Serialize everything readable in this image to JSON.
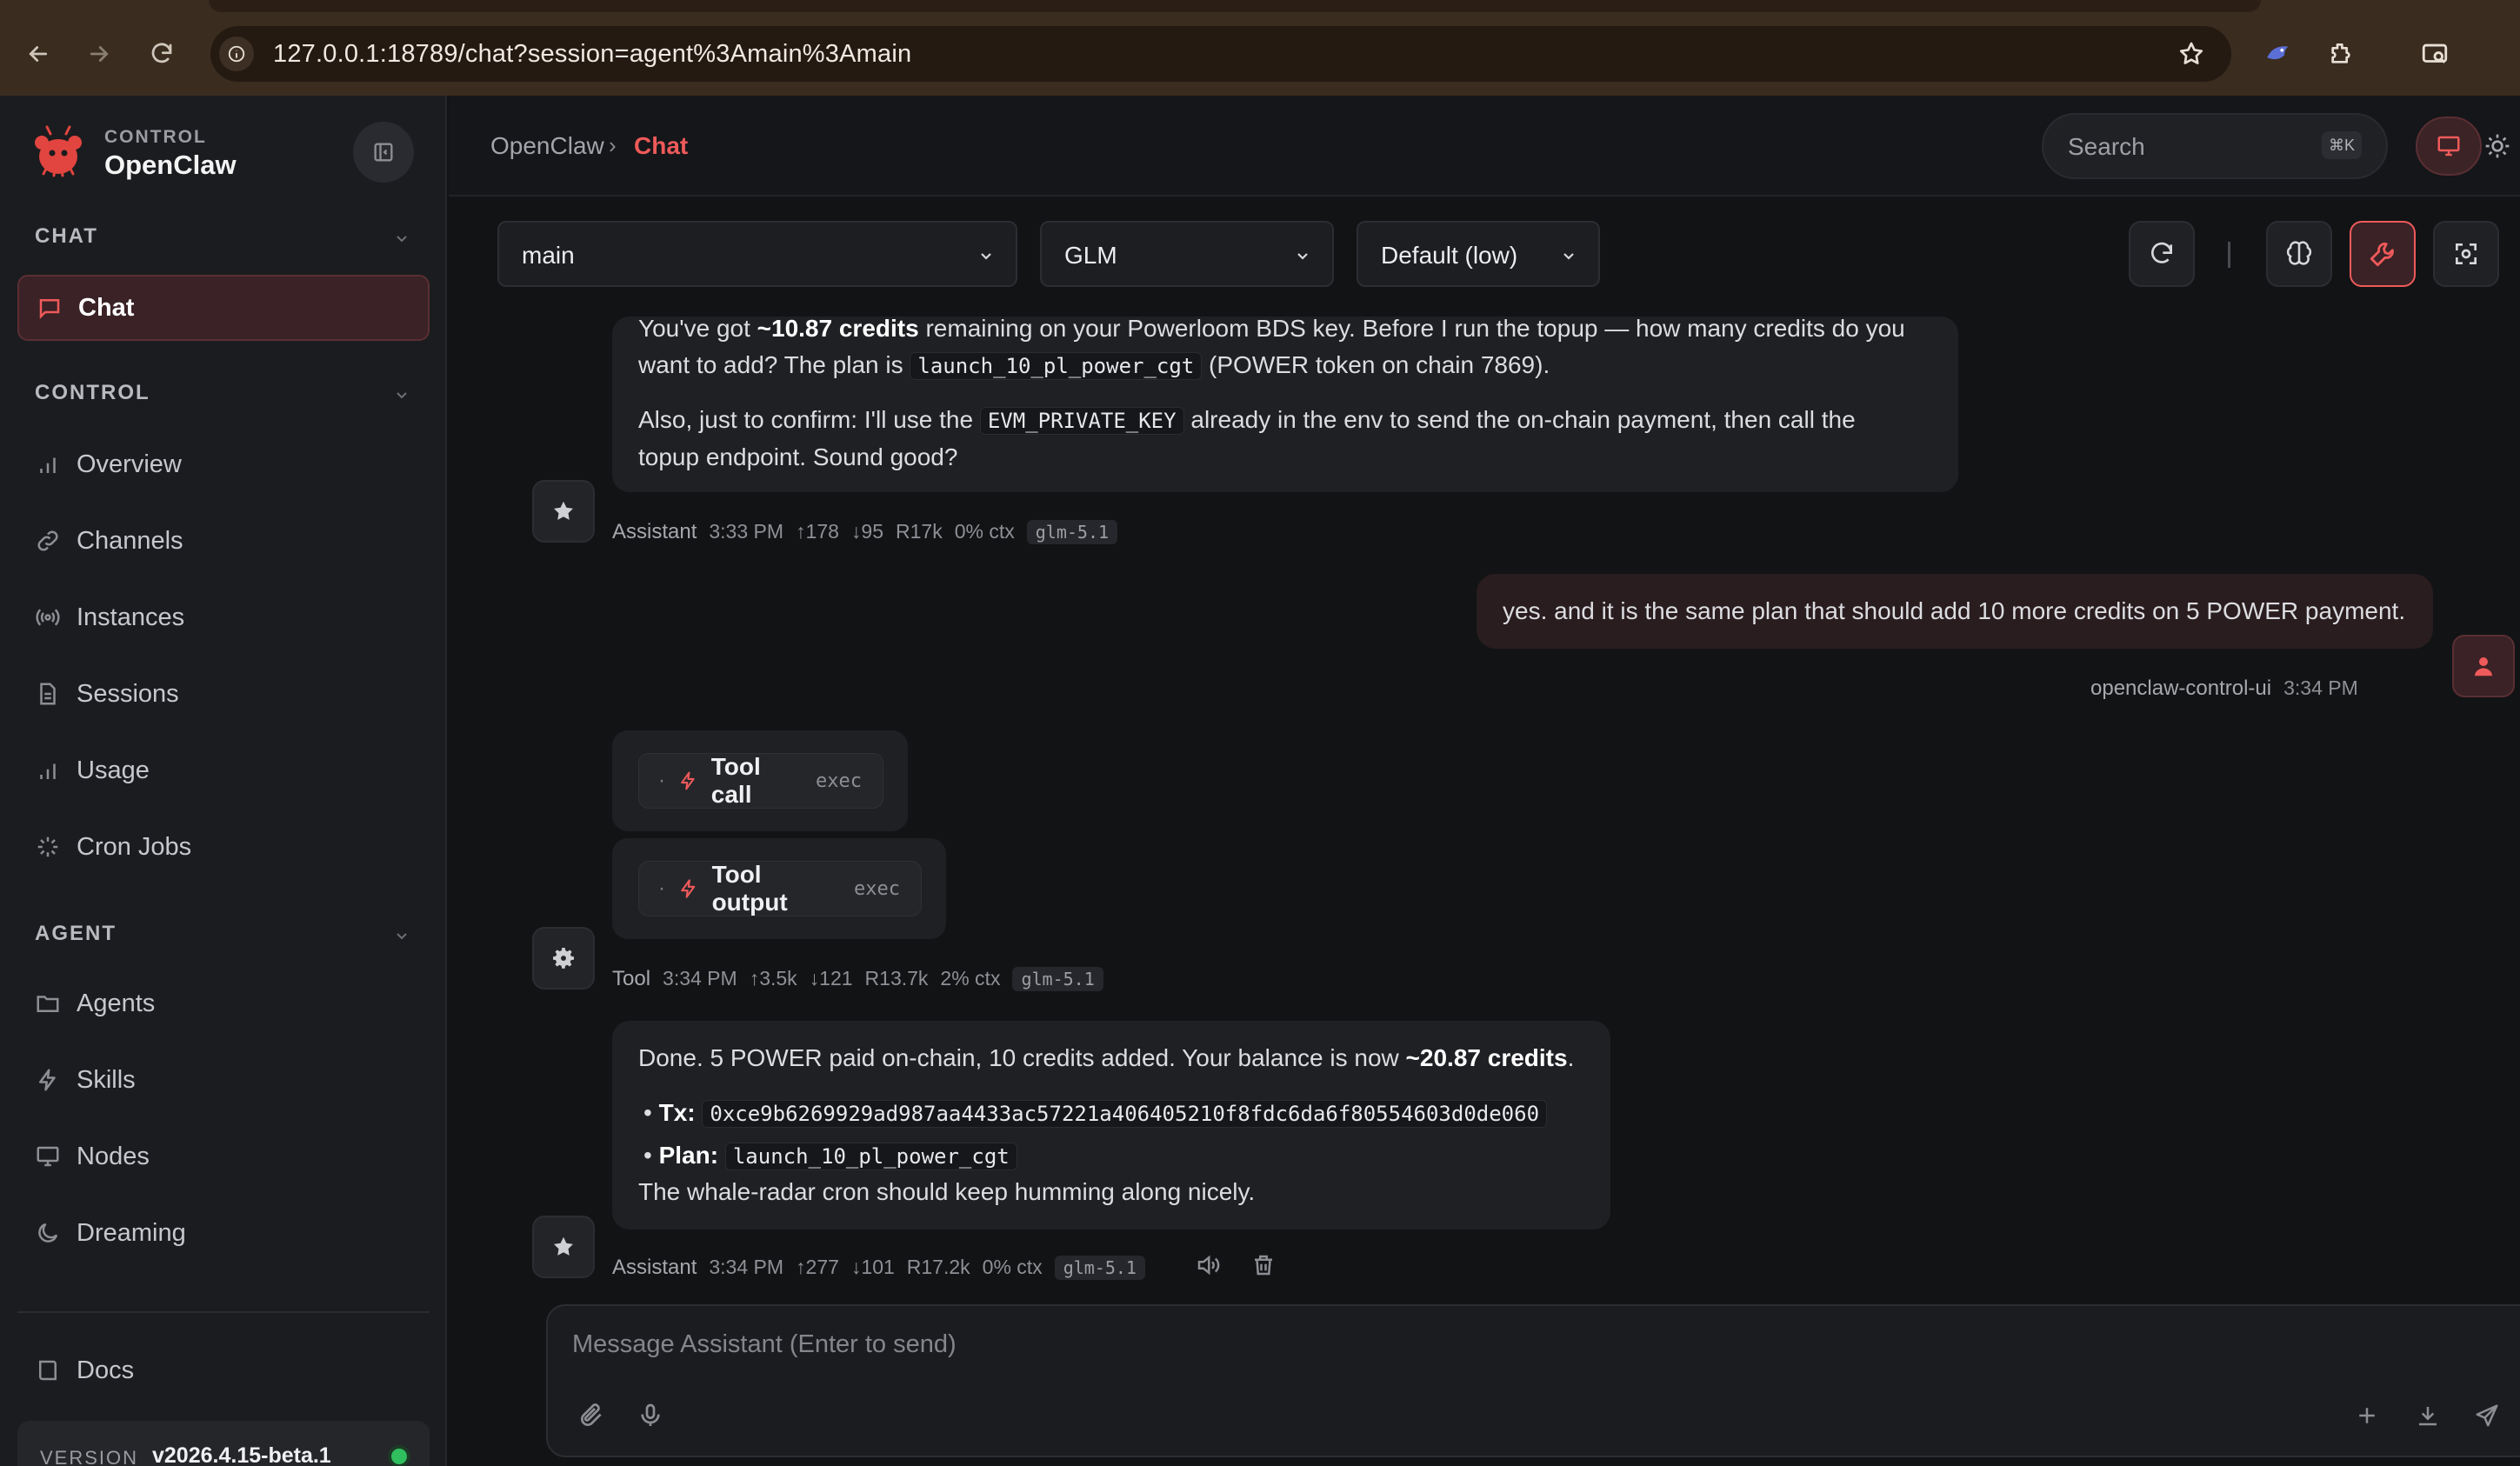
{
  "browser": {
    "url": "127.0.0.1:18789/chat?session=agent%3Amain%3Amain"
  },
  "brand": {
    "kicker": "CONTROL",
    "name": "OpenClaw"
  },
  "sidebar": {
    "sections": [
      {
        "title": "CHAT",
        "items": [
          {
            "label": "Chat",
            "active": true,
            "icon": "chat-bubble-icon"
          }
        ]
      },
      {
        "title": "CONTROL",
        "items": [
          {
            "label": "Overview",
            "icon": "bar-chart-icon"
          },
          {
            "label": "Channels",
            "icon": "link-icon"
          },
          {
            "label": "Instances",
            "icon": "radio-icon"
          },
          {
            "label": "Sessions",
            "icon": "file-icon"
          },
          {
            "label": "Usage",
            "icon": "bar-chart-icon"
          },
          {
            "label": "Cron Jobs",
            "icon": "loader-icon"
          }
        ]
      },
      {
        "title": "AGENT",
        "items": [
          {
            "label": "Agents",
            "icon": "folder-icon"
          },
          {
            "label": "Skills",
            "icon": "bolt-icon"
          },
          {
            "label": "Nodes",
            "icon": "monitor-icon"
          },
          {
            "label": "Dreaming",
            "icon": "moon-icon"
          }
        ]
      }
    ],
    "docs": "Docs",
    "version_label": "VERSION",
    "version_value": "v2026.4.15-beta.1"
  },
  "header": {
    "breadcrumb_root": "OpenClaw",
    "breadcrumb_sep": "›",
    "breadcrumb_current": "Chat",
    "search_placeholder": "Search",
    "search_shortcut": "⌘K"
  },
  "controls": {
    "session": "main",
    "model": "GLM",
    "thinking": "Default (low)"
  },
  "messages": {
    "m1": {
      "p1_a": "You've got ",
      "p1_b": "~10.87 credits",
      "p1_c": " remaining on your Powerloom BDS key. Before I run the topup — how many credits do you",
      "p1_d": "want to add? The plan is ",
      "p1_code": "launch_10_pl_power_cgt",
      "p1_e": " (POWER token on chain 7869).",
      "p2_a": "Also, just to confirm: I'll use the ",
      "p2_code": "EVM_PRIVATE_KEY",
      "p2_b": " already in the env to send the on-chain payment, then call the",
      "p2_c": "topup endpoint. Sound good?",
      "role": "Assistant",
      "time": "3:33 PM",
      "up": "↑178",
      "down": "↓95",
      "r": "R17k",
      "ctx": "0% ctx",
      "model": "glm-5.1"
    },
    "m2": {
      "text": "yes. and it is the same plan that should add 10 more credits on 5 POWER payment.",
      "sender": "openclaw-control-ui",
      "time": "3:34 PM"
    },
    "m3": {
      "call_label": "Tool call",
      "call_kind": "exec",
      "output_label": "Tool output",
      "output_kind": "exec",
      "role": "Tool",
      "time": "3:34 PM",
      "up": "↑3.5k",
      "down": "↓121",
      "r": "R13.7k",
      "ctx": "2% ctx",
      "model": "glm-5.1"
    },
    "m4": {
      "p1_a": "Done. 5 POWER paid on-chain, 10 credits added. Your balance is now ",
      "p1_b": "~20.87 credits",
      "p1_c": ".",
      "tx_label": "Tx:",
      "tx_value": "0xce9b6269929ad987aa4433ac57221a406405210f8fdc6da6f80554603d0de060",
      "plan_label": "Plan:",
      "plan_value": "launch_10_pl_power_cgt",
      "p2": "The whale-radar cron should keep humming along nicely.",
      "role": "Assistant",
      "time": "3:34 PM",
      "up": "↑277",
      "down": "↓101",
      "r": "R17.2k",
      "ctx": "0% ctx",
      "model": "glm-5.1"
    }
  },
  "composer": {
    "placeholder": "Message Assistant (Enter to send)"
  },
  "colors": {
    "accent": "#ef5a5a",
    "online": "#2fbf5e"
  }
}
